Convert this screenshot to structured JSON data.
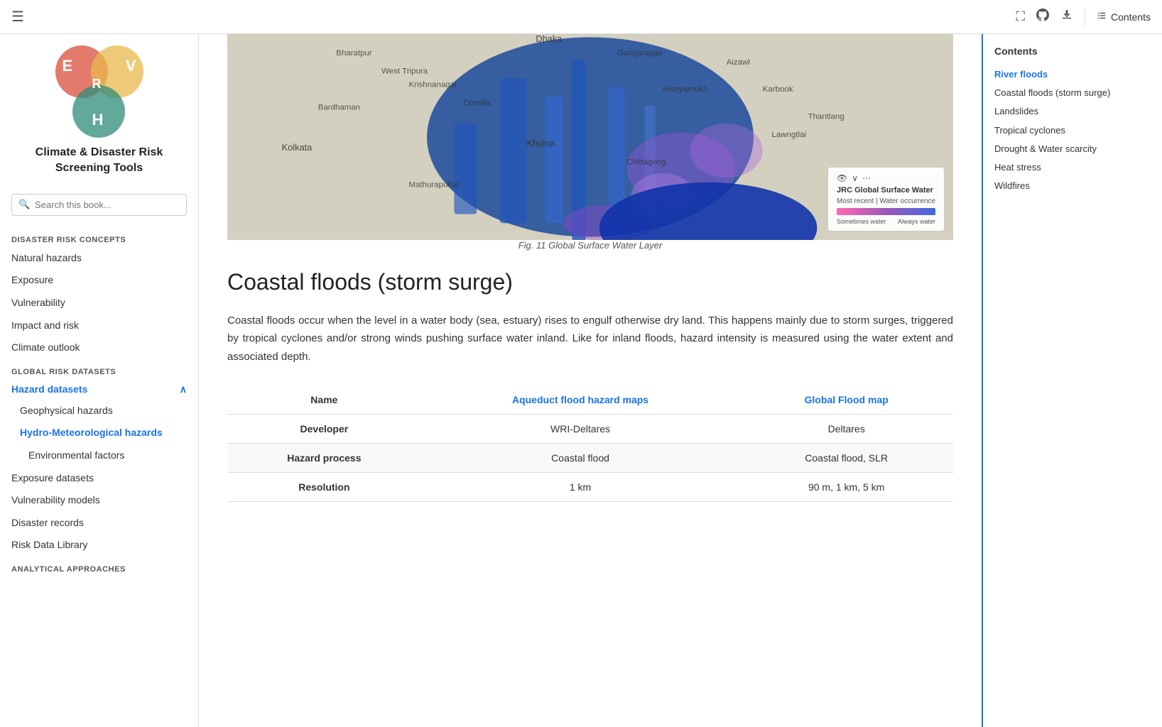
{
  "topbar": {
    "hamburger_label": "☰",
    "fullscreen_label": "⛶",
    "github_label": "⎇",
    "download_label": "⬇",
    "contents_label": "Contents"
  },
  "logo": {
    "title": "Climate & Disaster Risk\nScreening Tools",
    "letters": {
      "E": "E",
      "V": "V",
      "R": "R",
      "H": "H"
    }
  },
  "search": {
    "placeholder": "Search this book..."
  },
  "sidebar": {
    "section1_label": "Disaster Risk Concepts",
    "items_section1": [
      {
        "label": "Natural hazards",
        "active": false
      },
      {
        "label": "Exposure",
        "active": false
      },
      {
        "label": "Vulnerability",
        "active": false
      },
      {
        "label": "Impact and risk",
        "active": false
      },
      {
        "label": "Climate outlook",
        "active": false
      }
    ],
    "section2_label": "Global Risk Datasets",
    "hazard_datasets_label": "Hazard datasets",
    "items_section2": [
      {
        "label": "Geophysical hazards",
        "indent": 1
      },
      {
        "label": "Hydro-Meteorological hazards",
        "indent": 1,
        "active_blue": true
      },
      {
        "label": "Environmental factors",
        "indent": 2
      },
      {
        "label": "Exposure datasets",
        "indent": 0
      },
      {
        "label": "Vulnerability models",
        "indent": 0
      },
      {
        "label": "Disaster records",
        "indent": 0
      },
      {
        "label": "Risk Data Library",
        "indent": 0
      }
    ],
    "section3_label": "Analytical Approaches"
  },
  "right_toc": {
    "title": "Contents",
    "items": [
      {
        "label": "River floods",
        "active": true
      },
      {
        "label": "Coastal floods (storm surge)",
        "active": false
      },
      {
        "label": "Landslides",
        "active": false
      },
      {
        "label": "Tropical cyclones",
        "active": false
      },
      {
        "label": "Drought & Water scarcity",
        "active": false
      },
      {
        "label": "Heat stress",
        "active": false
      },
      {
        "label": "Wildfires",
        "active": false
      }
    ]
  },
  "content": {
    "map_caption": "Fig. 11 Global Surface Water Layer",
    "section_title": "Coastal floods (storm surge)",
    "body_text": "Coastal floods occur when the level in a water body (sea, estuary) rises to engulf otherwise dry land. This happens mainly due to storm surges, triggered by tropical cyclones and/or strong winds pushing surface water inland. Like for inland floods, hazard intensity is measured using the water extent and associated depth.",
    "table": {
      "headers": [
        "Name",
        "Aqueduct flood hazard maps",
        "Global Flood map"
      ],
      "rows": [
        {
          "label": "Developer",
          "col1": "WRI-Deltares",
          "col2": "Deltares"
        },
        {
          "label": "Hazard process",
          "col1": "Coastal flood",
          "col2": "Coastal flood, SLR"
        },
        {
          "label": "Resolution",
          "col1": "1 km",
          "col2": "90 m, 1 km, 5 km"
        }
      ]
    },
    "map_legend": {
      "title": "JRC Global Surface Water",
      "subtitle1": "Most recent | Water occurrence",
      "label_left": "Sometimes water",
      "label_right": "Always water"
    }
  }
}
